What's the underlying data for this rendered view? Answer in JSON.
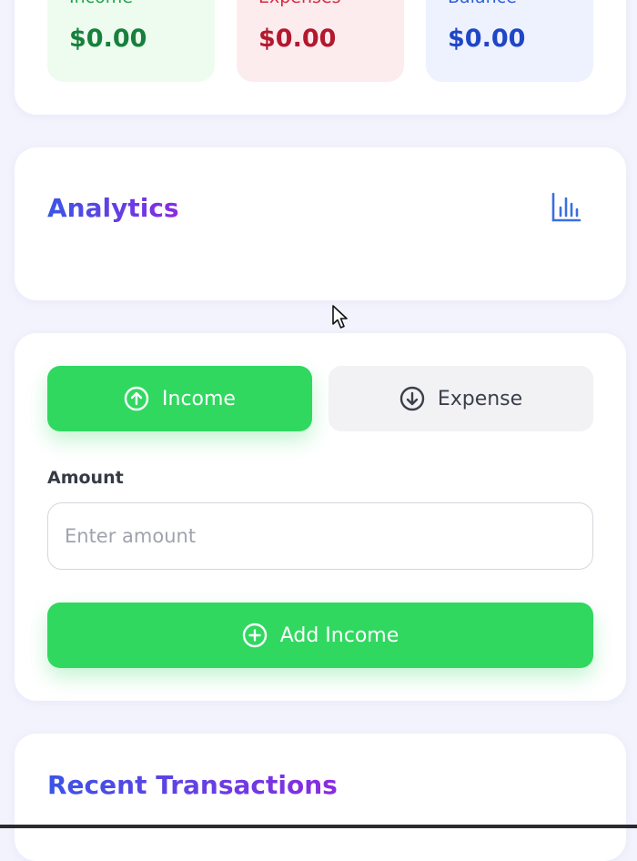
{
  "summary": {
    "income": {
      "label": "Income",
      "value": "$0.00"
    },
    "expenses": {
      "label": "Expenses",
      "value": "$0.00"
    },
    "balance": {
      "label": "Balance",
      "value": "$0.00"
    }
  },
  "analytics": {
    "title": "Analytics",
    "icon": "bar-chart-icon"
  },
  "form": {
    "toggle_income": {
      "label": "Income",
      "icon": "arrow-up-circle-icon"
    },
    "toggle_expense": {
      "label": "Expense",
      "icon": "arrow-down-circle-icon"
    },
    "amount_label": "Amount",
    "amount_placeholder": "Enter amount",
    "amount_value": "",
    "submit": {
      "label": "Add Income",
      "icon": "plus-circle-icon"
    }
  },
  "transactions": {
    "title": "Recent Transactions"
  },
  "colors": {
    "accent_green": "#30d860",
    "income_text": "#17803d",
    "expense_text": "#b3182e",
    "balance_text": "#1f46c7",
    "title_gradient_start": "#3b55e6",
    "title_gradient_end": "#8a2be2"
  }
}
